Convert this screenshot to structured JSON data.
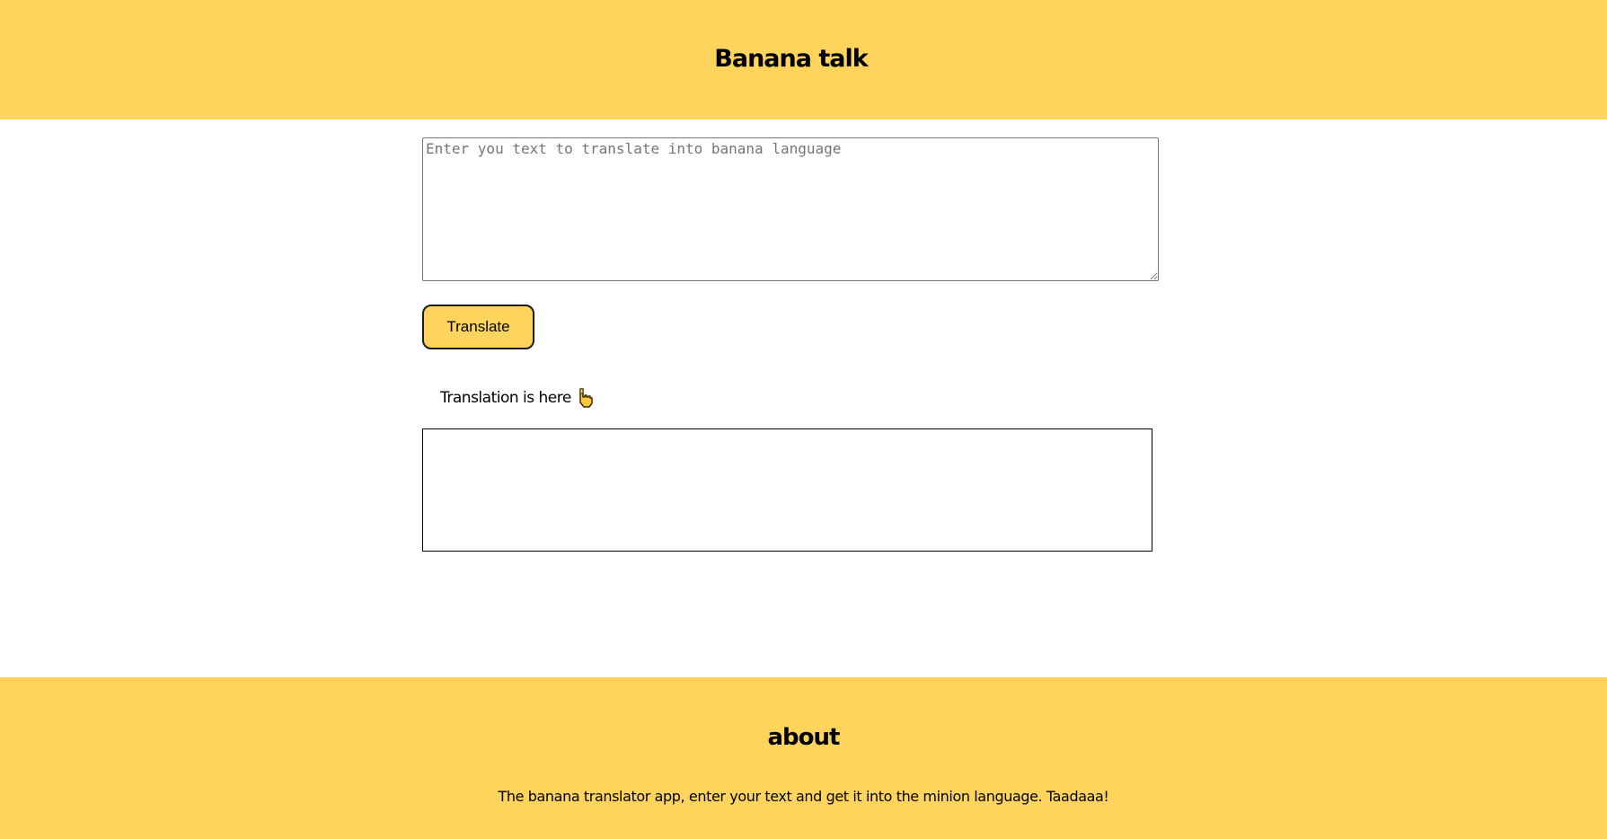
{
  "header": {
    "title": "Banana talk"
  },
  "input": {
    "placeholder": "Enter you text to translate into banana language",
    "value": ""
  },
  "translate_button": {
    "label": "Translate"
  },
  "output": {
    "label": "Translation is here",
    "icon": "hand-pointing-down-icon",
    "value": ""
  },
  "footer": {
    "heading": "about",
    "description": "The banana translator app, enter your text and get it into the minion language. Taadaaa!"
  },
  "colors": {
    "accent": "#ffd45c",
    "background": "#ffffff",
    "text": "#000000"
  }
}
